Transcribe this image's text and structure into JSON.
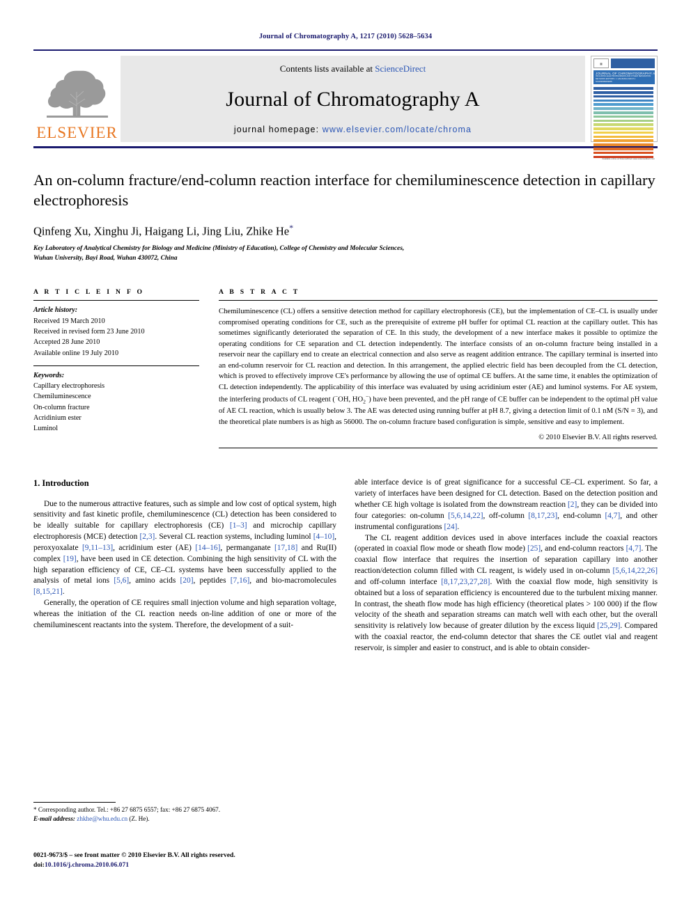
{
  "running_head": "Journal of Chromatography A, 1217 (2010) 5628–5634",
  "masthead": {
    "contents_prefix": "Contents lists available at ",
    "sciencedirect": "ScienceDirect",
    "journal_title": "Journal of Chromatography A",
    "homepage_label": "journal homepage: ",
    "homepage_url": "www.elsevier.com/locate/chroma",
    "publisher_wordmark": "ELSEVIER",
    "accent_orange": "#E87722",
    "accent_blue": "#2b56b5",
    "rule_navy": "#1a1a6e"
  },
  "cover": {
    "title": "JOURNAL OF CHROMATOGRAPHY A",
    "subtitle": "INCLUDING ELECTROPHORESIS AND OTHER SEPARATION METHODS\nEDITORS: J. HAGINAKA AND P.J. SCHOENMAKERS",
    "footer": "Available online at\nScienceDirect\nwww.sciencedirect.com",
    "stripe_colors": [
      "#2e5fa3",
      "#2e5fa3",
      "#2e5fa3",
      "#3f86c4",
      "#4f9ccf",
      "#6fb3c9",
      "#7fbfae",
      "#8cc79a",
      "#a8cf86",
      "#c8d872",
      "#e2d85f",
      "#f1cf4a",
      "#f3bb3c",
      "#f0a233",
      "#ea8a2c",
      "#e06a25",
      "#d9501f",
      "#cf3a1a"
    ]
  },
  "article": {
    "title": "An on-column fracture/end-column reaction interface for chemiluminescence detection in capillary electrophoresis",
    "authors": "Qinfeng Xu, Xinghu Ji, Haigang Li, Jing Liu, Zhike He",
    "corresponding_marker": "*",
    "affiliation_line1": "Key Laboratory of Analytical Chemistry for Biology and Medicine (Ministry of Education), College of Chemistry and Molecular Sciences,",
    "affiliation_line2": "Wuhan University, Bayi Road, Wuhan 430072, China"
  },
  "article_info": {
    "heading": "A R T I C L E   I N F O",
    "history_label": "Article history:",
    "history": [
      "Received 19 March 2010",
      "Received in revised form 23 June 2010",
      "Accepted 28 June 2010",
      "Available online 19 July 2010"
    ],
    "keywords_label": "Keywords:",
    "keywords": [
      "Capillary electrophoresis",
      "Chemiluminescence",
      "On-column fracture",
      "Acridinium ester",
      "Luminol"
    ]
  },
  "abstract": {
    "heading": "A B S T R A C T",
    "part1": "Chemiluminescence (CL) offers a sensitive detection method for capillary electrophoresis (CE), but the implementation of CE–CL is usually under compromised operating conditions for CE, such as the prerequisite of extreme pH buffer for optimal CL reaction at the capillary outlet. This has sometimes significantly deteriorated the separation of CE. In this study, the development of a new interface makes it possible to optimize the operating conditions for CE separation and CL detection independently. The interface consists of an on-column fracture being installed in a reservoir near the capillary end to create an electrical connection and also serve as reagent addition entrance. The capillary terminal is inserted into an end-column reservoir for CL reaction and detection. In this arrangement, the applied electric field has been decoupled from the CL detection, which is proved to effectively improve CE's performance by allowing the use of optimal CE buffers. At the same time, it enables the optimization of CL detection independently. The applicability of this interface was evaluated by using acridinium ester (AE) and luminol systems. For AE system, the interfering products of CL reagent (",
    "chem1": "OH, HO",
    "chem_sub": "2",
    "chem2": ") have been prevented, and the pH range of CE buffer can be independent to the optimal pH value of AE CL reaction, which is usually below 3. The AE was detected using running buffer at pH 8.7, giving a detection limit of 0.1 nM (S/N = 3), and the theoretical plate numbers is as high as 56000. The on-column fracture based configuration is simple, sensitive and easy to implement.",
    "copyright": "© 2010 Elsevier B.V. All rights reserved."
  },
  "body": {
    "section_number_title": "1.  Introduction",
    "left_para1_a": "Due to the numerous attractive features, such as simple and low cost of optical system, high sensitivity and fast kinetic profile, chemiluminescence (CL) detection has been considered to be ideally suitable for capillary electrophoresis (CE) ",
    "ref_1_3": "[1–3]",
    "left_para1_b": " and microchip capillary electrophoresis (MCE) detection ",
    "ref_2_3": "[2,3]",
    "left_para1_c": ". Several CL reaction systems, including luminol ",
    "ref_4_10": "[4–10]",
    "left_para1_d": ", peroxyoxalate ",
    "ref_9_11_13": "[9,11–13]",
    "left_para1_e": ", acridinium ester (AE) ",
    "ref_14_16": "[14–16]",
    "left_para1_f": ", permanganate ",
    "ref_17_18": "[17,18]",
    "left_para1_g": " and Ru(II) complex ",
    "ref_19": "[19]",
    "left_para1_h": ", have been used in CE detection. Combining the high sensitivity of CL with the high separation efficiency of CE, CE–CL systems have been successfully applied to the analysis of metal ions ",
    "ref_5_6": "[5,6]",
    "left_para1_i": ", amino acids ",
    "ref_20": "[20]",
    "left_para1_j": ", peptides ",
    "ref_7_16": "[7,16]",
    "left_para1_k": ", and bio-macromolecules ",
    "ref_8_15_21": "[8,15,21]",
    "left_para1_l": ".",
    "left_para2": "Generally, the operation of CE requires small injection volume and high separation voltage, whereas the initiation of the CL reaction needs on-line addition of one or more of the chemiluminescent reactants into the system. Therefore, the development of a suit-",
    "right_para1_a": "able interface device is of great significance for a successful CE–CL experiment. So far, a variety of interfaces have been designed for CL detection. Based on the detection position and whether CE high voltage is isolated from the downstream reaction ",
    "ref_2": "[2]",
    "right_para1_b": ", they can be divided into four categories: on-column ",
    "ref_5_6_14_22": "[5,6,14,22]",
    "right_para1_c": ", off-column ",
    "ref_8_17_23": "[8,17,23]",
    "right_para1_d": ", end-column ",
    "ref_4_7": "[4,7]",
    "right_para1_e": ", and other instrumental configurations ",
    "ref_24": "[24]",
    "right_para1_f": ".",
    "right_para2_a": "The CL reagent addition devices used in above interfaces include the coaxial reactors (operated in coaxial flow mode or sheath flow mode) ",
    "ref_25": "[25]",
    "right_para2_b": ", and end-column reactors ",
    "ref_4_7b": "[4,7]",
    "right_para2_c": ". The coaxial flow interface that requires the insertion of separation capillary into another reaction/detection column filled with CL reagent, is widely used in on-column ",
    "ref_5_6_14_22_26": "[5,6,14,22,26]",
    "right_para2_d": " and off-column interface ",
    "ref_8_17_23_27_28": "[8,17,23,27,28]",
    "right_para2_e": ". With the coaxial flow mode, high sensitivity is obtained but a loss of separation efficiency is encountered due to the turbulent mixing manner. In contrast, the sheath flow mode has high efficiency (theoretical plates > 100 000) if the flow velocity of the sheath and separation streams can match well with each other, but the overall sensitivity is relatively low because of greater dilution by the excess liquid ",
    "ref_25_29": "[25,29]",
    "right_para2_f": ". Compared with the coaxial reactor, the end-column detector that shares the CE outlet vial and reagent reservoir, is simpler and easier to construct, and is able to obtain consider-"
  },
  "footnote": {
    "line1": "* Corresponding author. Tel.: +86 27 6875 6557; fax: +86 27 6875 4067.",
    "email_label": "E-mail address:",
    "email": "zhkhe@whu.edu.cn",
    "email_suffix": " (Z. He)."
  },
  "imprint": {
    "line1": "0021-9673/$ – see front matter © 2010 Elsevier B.V. All rights reserved.",
    "doi_label": "doi:",
    "doi": "10.1016/j.chroma.2010.06.071"
  }
}
